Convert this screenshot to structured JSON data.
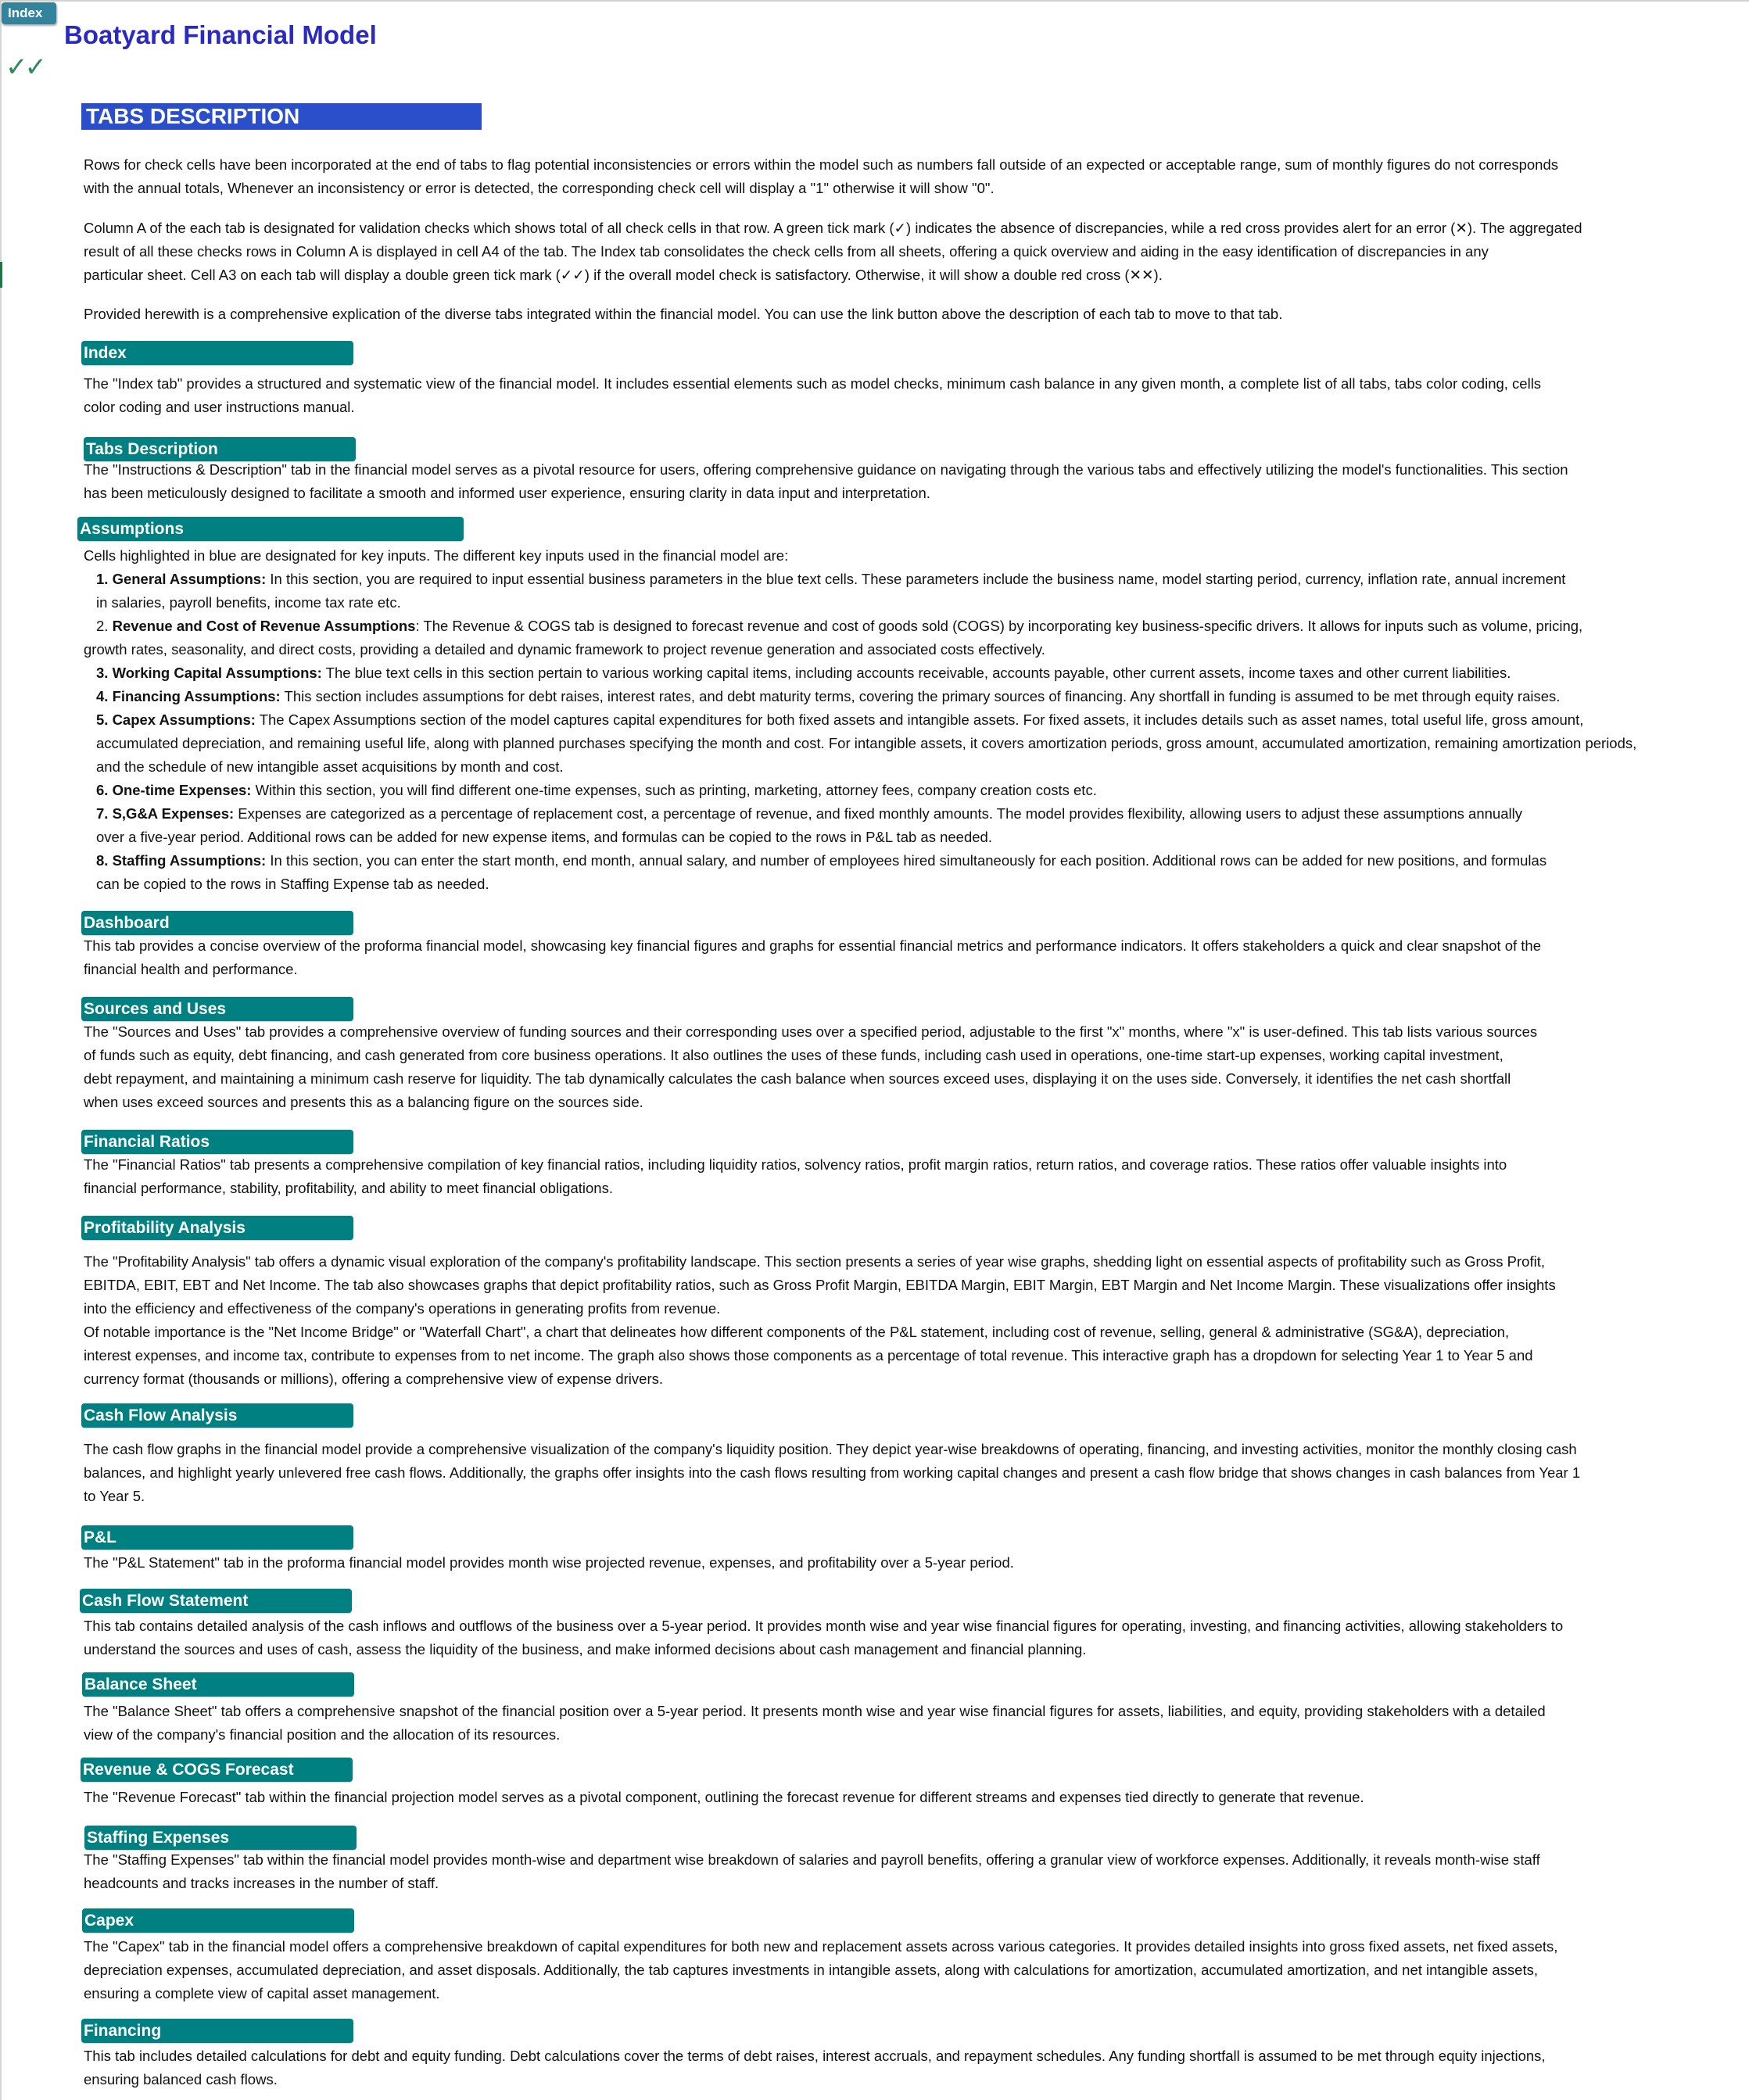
{
  "nav": {
    "index_button": "Index"
  },
  "header": {
    "title": "Boatyard Financial Model",
    "model_check": "✓✓",
    "banner": "TABS DESCRIPTION"
  },
  "colors": {
    "title": "#2a2ac0",
    "banner": "#2b4fcb",
    "section_header": "#008080",
    "index_button": "#31849b",
    "check_ok": "#2e8b57"
  },
  "intro": [
    "Rows for check cells have been incorporated at the end of tabs to flag potential inconsistencies or errors within the model such as numbers fall outside of an expected or acceptable range, sum of monthly figures do not corresponds\nwith the annual totals, Whenever an inconsistency or error is detected, the corresponding check cell will display a \"1\" otherwise it will show \"0\".",
    "Column A of the each tab is designated for validation checks which shows total of all check cells in that row. A green tick mark (✓) indicates the absence of discrepancies, while a red cross provides alert for an error (✕). The aggregated\nresult of all these checks rows in Column A is displayed in cell A4 of the tab. The Index tab consolidates the check cells from all sheets, offering a quick overview and aiding in the easy identification of discrepancies in any\nparticular sheet. Cell A3 on each tab will display a double green tick mark (✓✓) if the overall model check is satisfactory. Otherwise, it will show a double red cross (✕✕).",
    "Provided herewith is a comprehensive explication of the diverse tabs integrated within the financial model. You can use the link button above the description of each tab to move to that tab."
  ],
  "sections": {
    "index": {
      "title": "Index",
      "text": "The \"Index tab\" provides a structured and systematic view of the financial model. It includes essential elements such as model checks, minimum cash balance in any given month, a complete list of all tabs, tabs color coding, cells\ncolor coding and user instructions manual."
    },
    "tabs_description": {
      "title": "Tabs Description",
      "text": "The \"Instructions & Description\" tab in the financial model serves as a pivotal resource for users, offering comprehensive guidance on navigating through the various tabs and effectively utilizing the model's functionalities. This section\nhas been meticulously designed to facilitate a smooth and informed user experience, ensuring clarity in data input and interpretation."
    },
    "assumptions": {
      "title": "Assumptions",
      "intro": "Cells highlighted in blue are designated for key inputs. The different key inputs used in the financial model are:",
      "items": [
        {
          "label": "1. General Assumptions:",
          "lines": [
            " In this section, you are required to input essential business parameters in the blue text cells. These parameters include the business name, model starting period, currency, inflation rate, annual increment",
            "in salaries, payroll benefits, income tax rate etc."
          ]
        },
        {
          "label": "Revenue and Cost of Revenue Assumptions",
          "prefix": "2. ",
          "lines": [
            ": The Revenue & COGS tab is designed to forecast revenue and cost of goods sold (COGS) by incorporating key business-specific drivers. It allows for inputs such as volume, pricing,",
            "growth rates, seasonality, and direct costs, providing a detailed and dynamic framework to project revenue generation and associated costs effectively."
          ]
        },
        {
          "label": "3. Working Capital Assumptions:",
          "lines": [
            " The blue text cells in this section pertain to various working capital items, including accounts receivable,  accounts payable, other current assets, income taxes and other current liabilities."
          ]
        },
        {
          "label": "4. Financing Assumptions:",
          "lines": [
            " This section includes assumptions for debt raises, interest rates, and debt maturity terms, covering the primary sources of financing. Any shortfall in funding is assumed to be met through equity raises."
          ]
        },
        {
          "label": "5. Capex Assumptions:",
          "lines": [
            " The Capex Assumptions section of the model captures capital expenditures for both fixed assets and intangible assets. For fixed assets, it includes details such as asset names, total useful life, gross amount,",
            "accumulated depreciation, and remaining useful life, along with planned purchases specifying the month and cost. For intangible assets, it covers amortization periods, gross amount, accumulated amortization, remaining amortization periods,",
            "and the schedule of new intangible asset acquisitions by month and cost."
          ]
        },
        {
          "label": "6. One-time Expenses:",
          "lines": [
            " Within this section, you will find different one-time expenses, such as printing, marketing, attorney fees, company creation costs etc."
          ]
        },
        {
          "label": "7. S,G&A Expenses:",
          "lines": [
            "  Expenses are categorized as a percentage of replacement cost, a percentage of revenue, and fixed monthly amounts. The model provides flexibility, allowing users to adjust these assumptions annually",
            "over a five-year period. Additional rows can be added for new expense items, and formulas can be copied to the rows in  P&L tab as needed."
          ]
        },
        {
          "label": "8. Staffing Assumptions:",
          "lines": [
            " In this section, you can enter the start month, end month, annual salary, and number of employees hired simultaneously for each position. Additional rows can be added for new positions, and formulas",
            "can be copied to the rows in Staffing Expense tab as needed."
          ]
        }
      ]
    },
    "dashboard": {
      "title": "Dashboard",
      "text": "This tab provides a concise overview of the proforma financial model, showcasing key financial figures and graphs for essential financial metrics and performance indicators. It offers stakeholders a quick and clear snapshot of the\nfinancial health and performance."
    },
    "sources_uses": {
      "title": "Sources and Uses",
      "text": "The \"Sources and Uses\" tab provides a comprehensive overview of funding sources and their corresponding uses over a specified period, adjustable to the first \"x\" months, where \"x\" is user-defined. This tab lists various sources\nof funds such as equity, debt financing, and cash generated from core business operations. It also outlines the uses of these funds, including cash used in operations, one-time start-up expenses, working capital investment,\ndebt repayment, and maintaining  a minimum cash reserve for liquidity. The tab dynamically calculates the cash balance when sources exceed uses, displaying it on the uses side. Conversely, it identifies the net cash shortfall\nwhen uses exceed sources and presents this as a balancing figure on the sources side."
    },
    "financial_ratios": {
      "title": "Financial Ratios",
      "text": "The \"Financial Ratios\" tab presents a comprehensive compilation of key financial ratios, including liquidity ratios, solvency ratios, profit margin ratios, return ratios, and coverage ratios. These ratios offer valuable insights into\nfinancial performance, stability, profitability, and ability to meet financial obligations."
    },
    "profitability": {
      "title": "Profitability Analysis",
      "text": "The \"Profitability Analysis\" tab offers a dynamic visual exploration of the company's profitability landscape. This section presents a series of year wise graphs, shedding light on essential aspects of profitability such as Gross Profit,\nEBITDA, EBIT, EBT and Net Income. The tab also showcases graphs that depict profitability ratios, such as Gross Profit Margin, EBITDA Margin, EBIT Margin, EBT Margin and Net Income Margin. These visualizations offer insights\ninto the efficiency and effectiveness of the company's operations in generating profits from revenue.\nOf notable importance is the \"Net Income Bridge\" or \"Waterfall Chart\", a chart that delineates how different components of the P&L statement, including cost of revenue, selling, general & administrative (SG&A), depreciation,\ninterest expenses, and income tax, contribute to expenses from to net income. The graph also shows those components as a percentage of total revenue. This interactive graph has a dropdown for selecting Year 1 to Year 5 and\ncurrency format (thousands or millions), offering a comprehensive view of expense drivers."
    },
    "cash_flow_analysis": {
      "title": "Cash Flow Analysis",
      "text": "The cash flow graphs in the financial model provide a comprehensive visualization of the company's liquidity position. They depict year-wise breakdowns of operating, financing, and investing activities, monitor the monthly closing cash\nbalances, and highlight yearly unlevered free cash flows. Additionally, the graphs offer insights into the cash flows resulting from working capital changes and present a cash flow bridge that shows changes in cash balances from Year 1\nto Year 5."
    },
    "pl": {
      "title": "P&L",
      "text": "The \"P&L Statement\" tab in the proforma financial model provides month wise projected revenue, expenses, and profitability over a 5-year period."
    },
    "cash_flow_statement": {
      "title": "Cash Flow Statement",
      "text": "This tab contains detailed analysis of the cash inflows and outflows of the business over a 5-year period. It provides month wise and year wise financial figures for operating, investing, and financing activities, allowing stakeholders to\nunderstand the sources and uses of cash, assess the liquidity of the business, and make informed decisions about cash management and financial planning."
    },
    "balance_sheet": {
      "title": "Balance Sheet",
      "text": "The \"Balance Sheet\" tab offers a comprehensive snapshot of the financial position over a 5-year period. It presents month wise and year wise financial figures for assets, liabilities, and equity, providing stakeholders with a detailed\nview of the company's financial position and the allocation of its resources."
    },
    "revenue_cogs": {
      "title": "Revenue & COGS Forecast",
      "text": "The \"Revenue Forecast\" tab within the financial projection model serves as a pivotal component, outlining the forecast revenue for different streams and expenses tied directly to generate that revenue."
    },
    "staffing": {
      "title": "Staffing Expenses",
      "text": "The \"Staffing Expenses\" tab within the financial model provides month-wise and department wise breakdown of salaries and payroll benefits, offering  a granular view of workforce expenses. Additionally, it reveals month-wise staff\nheadcounts and tracks increases in the number of staff."
    },
    "capex": {
      "title": "Capex",
      "text": "The \"Capex\" tab in the financial model offers a comprehensive breakdown of capital expenditures for both new and replacement assets across various categories. It provides detailed insights into gross fixed assets, net fixed assets,\ndepreciation expenses, accumulated depreciation, and asset disposals. Additionally, the tab captures investments in intangible assets, along with calculations for amortization, accumulated amortization, and net intangible assets,\nensuring a complete view of capital asset management."
    },
    "financing": {
      "title": "Financing",
      "text": "This tab includes detailed calculations for debt and equity funding. Debt calculations cover the terms of debt raises, interest accruals, and repayment schedules. Any funding shortfall is assumed to be met through equity injections,\nensuring balanced cash flows."
    }
  }
}
